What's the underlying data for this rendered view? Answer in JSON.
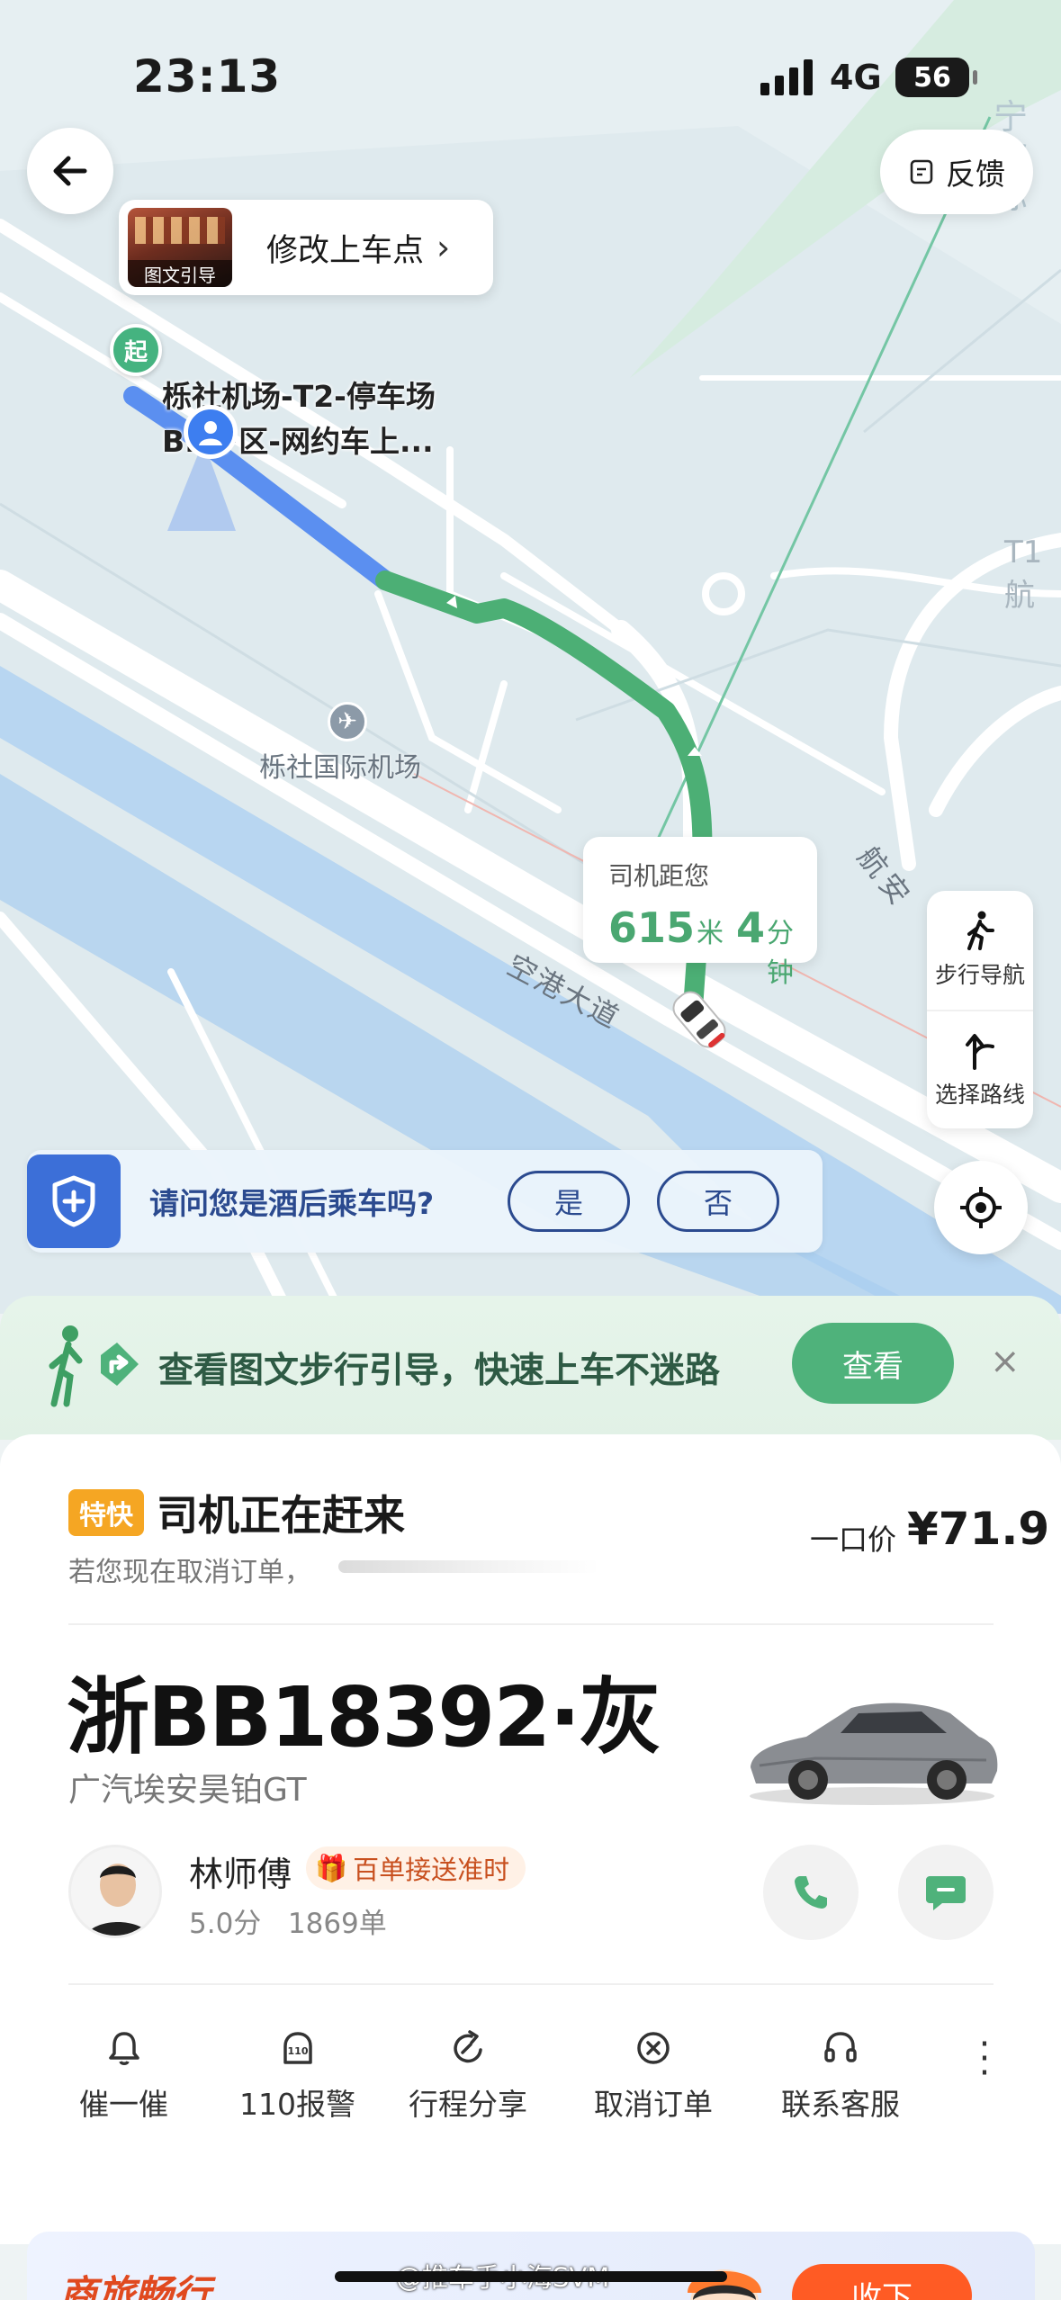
{
  "status_bar": {
    "time": "23:13",
    "network": "4G",
    "battery": "56"
  },
  "map": {
    "feedback_label": "反馈",
    "pickup_change_label": "修改上车点",
    "pickup_thumb_label": "图文引导",
    "start_marker": "起",
    "start_label_line1": "栎社机场-T2-停车场",
    "start_label_line2": "B...F区-网约车上...",
    "airport_label": "栎社国际机场",
    "road_label_1": "空港大道",
    "road_label_2": "航安",
    "t1_label": "T1航",
    "ningbo_label_1": "宁波",
    "ningbo_label_2": "际",
    "eta": {
      "title": "司机距您",
      "distance": "615",
      "distance_unit": "米",
      "minutes": "4",
      "minutes_unit": "分钟"
    },
    "side_tools": {
      "walk_nav": "步行导航",
      "choose_route": "选择路线"
    },
    "route_colors": {
      "walked": "#5b8ff0",
      "remaining": "#4caf75"
    }
  },
  "drunk_prompt": {
    "question": "请问您是酒后乘车吗?",
    "yes": "是",
    "no": "否"
  },
  "walk_guide": {
    "text": "查看图文步行引导，快速上车不迷路",
    "button": "查看",
    "close": "×"
  },
  "trip": {
    "tag": "特快",
    "status": "司机正在赶来",
    "cancel_hint": "若您现在取消订单，",
    "price_label": "一口价",
    "price": "¥71.9",
    "plate": "浙BB18392·灰",
    "car_model": "广汽埃安昊铂GT"
  },
  "driver": {
    "name": "林师傅",
    "badge": "百单接送准时",
    "rating": "5.0分",
    "orders": "1869单"
  },
  "actions": [
    {
      "label": "催一催",
      "icon": "bell-icon"
    },
    {
      "label": "110报警",
      "icon": "alarm-110-icon"
    },
    {
      "label": "行程分享",
      "icon": "share-icon"
    },
    {
      "label": "取消订单",
      "icon": "cancel-icon"
    },
    {
      "label": "联系客服",
      "icon": "headset-icon"
    }
  ],
  "promo": {
    "title": "商旅畅行",
    "button": "收下"
  },
  "watermark": "@推车手小海SVM",
  "colors": {
    "accent_green": "#4fb27b",
    "brand_blue": "#3c6fd8",
    "tag_orange": "#f5a623"
  }
}
